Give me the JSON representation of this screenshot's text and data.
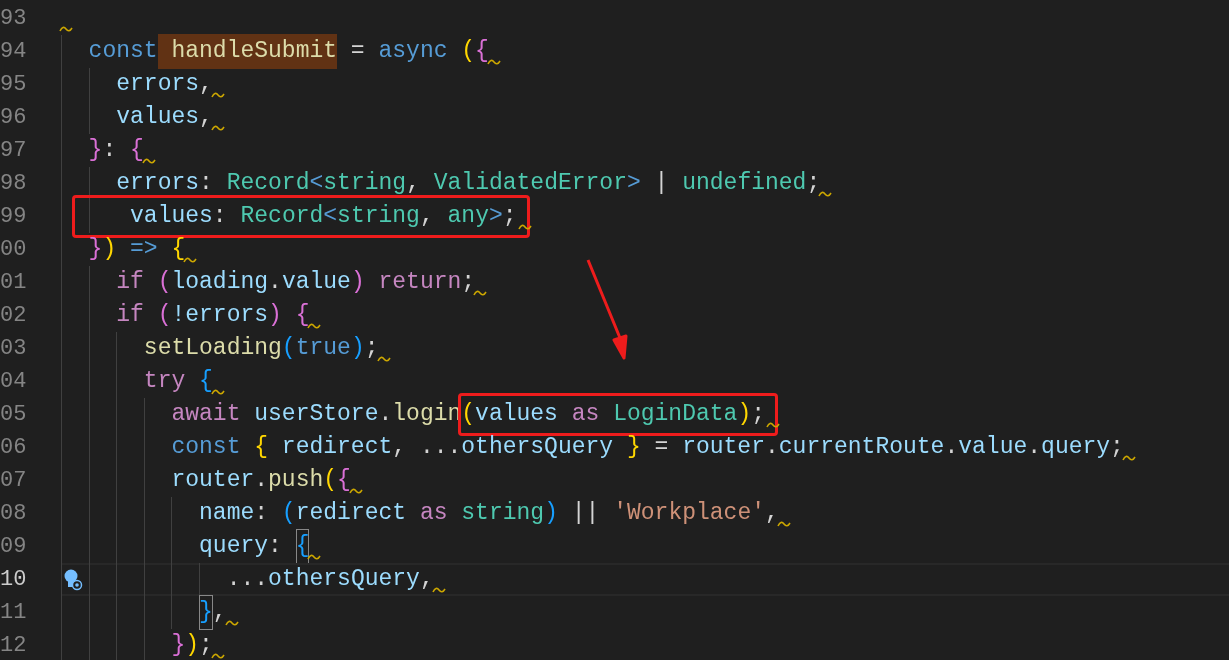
{
  "editor": {
    "lines": [
      {
        "number": "93",
        "current": false,
        "squiggle": true
      },
      {
        "number": "94",
        "current": false,
        "squiggle": true,
        "tokens": [
          {
            "text": "  const",
            "kind": "keyword"
          },
          {
            "text": " handleSubmit",
            "kind": "function",
            "highlighted": true
          },
          {
            "text": " = ",
            "kind": "punct"
          },
          {
            "text": "async",
            "kind": "keyword"
          },
          {
            "text": " (",
            "kind": "bracket1"
          },
          {
            "text": "{",
            "kind": "bracket2"
          }
        ]
      },
      {
        "number": "95",
        "current": false,
        "squiggle": true,
        "tokens": [
          {
            "text": "    errors",
            "kind": "variable"
          },
          {
            "text": ",",
            "kind": "punct"
          }
        ]
      },
      {
        "number": "96",
        "current": false,
        "squiggle": true,
        "tokens": [
          {
            "text": "    values",
            "kind": "variable"
          },
          {
            "text": ",",
            "kind": "punct"
          }
        ]
      },
      {
        "number": "97",
        "current": false,
        "squiggle": true,
        "tokens": [
          {
            "text": "  }",
            "kind": "bracket2"
          },
          {
            "text": ": ",
            "kind": "punct"
          },
          {
            "text": "{",
            "kind": "bracket2"
          }
        ]
      },
      {
        "number": "98",
        "current": false,
        "squiggle": true,
        "tokens": [
          {
            "text": "    errors",
            "kind": "variable"
          },
          {
            "text": ": ",
            "kind": "punct"
          },
          {
            "text": "Record",
            "kind": "type"
          },
          {
            "text": "<",
            "kind": "keyword"
          },
          {
            "text": "string",
            "kind": "type"
          },
          {
            "text": ", ",
            "kind": "punct"
          },
          {
            "text": "ValidatedError",
            "kind": "type"
          },
          {
            "text": ">",
            "kind": "keyword"
          },
          {
            "text": " | ",
            "kind": "punct"
          },
          {
            "text": "undefined",
            "kind": "type"
          },
          {
            "text": ";",
            "kind": "punct"
          }
        ]
      },
      {
        "number": "99",
        "current": false,
        "squiggle": true,
        "tokens": [
          {
            "kind": "annotation_box",
            "tokens": [
              {
                "text": "    values",
                "kind": "variable"
              },
              {
                "text": ": ",
                "kind": "punct"
              },
              {
                "text": "Record",
                "kind": "type"
              },
              {
                "text": "<",
                "kind": "keyword"
              },
              {
                "text": "string",
                "kind": "type"
              },
              {
                "text": ", ",
                "kind": "punct"
              },
              {
                "text": "any",
                "kind": "type"
              },
              {
                "text": ">",
                "kind": "keyword"
              },
              {
                "text": ";",
                "kind": "punct"
              }
            ]
          }
        ]
      },
      {
        "number": "00",
        "current": false,
        "squiggle": true,
        "tokens": [
          {
            "text": "  }",
            "kind": "bracket2"
          },
          {
            "text": ")",
            "kind": "bracket1"
          },
          {
            "text": " =>",
            "kind": "keyword"
          },
          {
            "text": " {",
            "kind": "bracket1"
          }
        ]
      },
      {
        "number": "01",
        "current": false,
        "squiggle": true,
        "tokens": [
          {
            "text": "    if",
            "kind": "control"
          },
          {
            "text": " (",
            "kind": "bracket2"
          },
          {
            "text": "loading",
            "kind": "variable"
          },
          {
            "text": ".",
            "kind": "punct"
          },
          {
            "text": "value",
            "kind": "variable"
          },
          {
            "text": ")",
            "kind": "bracket2"
          },
          {
            "text": " return",
            "kind": "control"
          },
          {
            "text": ";",
            "kind": "punct"
          }
        ]
      },
      {
        "number": "02",
        "current": false,
        "squiggle": true,
        "tokens": [
          {
            "text": "    if",
            "kind": "control"
          },
          {
            "text": " (",
            "kind": "bracket2"
          },
          {
            "text": "!errors",
            "kind": "variable"
          },
          {
            "text": ")",
            "kind": "bracket2"
          },
          {
            "text": " {",
            "kind": "bracket2"
          }
        ]
      },
      {
        "number": "03",
        "current": false,
        "squiggle": true,
        "tokens": [
          {
            "text": "      setLoading",
            "kind": "function"
          },
          {
            "text": "(",
            "kind": "bracket3"
          },
          {
            "text": "true",
            "kind": "keyword"
          },
          {
            "text": ")",
            "kind": "bracket3"
          },
          {
            "text": ";",
            "kind": "punct"
          }
        ]
      },
      {
        "number": "04",
        "current": false,
        "squiggle": true,
        "tokens": [
          {
            "text": "      try",
            "kind": "control"
          },
          {
            "text": " {",
            "kind": "bracket3"
          }
        ]
      },
      {
        "number": "05",
        "current": false,
        "squiggle": true,
        "tokens": [
          {
            "text": "        await",
            "kind": "control"
          },
          {
            "text": " userStore",
            "kind": "variable"
          },
          {
            "text": ".",
            "kind": "punct"
          },
          {
            "text": "login",
            "kind": "function"
          },
          {
            "kind": "annotation_box",
            "tokens": [
              {
                "text": "(",
                "kind": "bracket1"
              },
              {
                "text": "values",
                "kind": "variable"
              },
              {
                "text": " as",
                "kind": "control"
              },
              {
                "text": " LoginData",
                "kind": "type"
              },
              {
                "text": ")",
                "kind": "bracket1"
              },
              {
                "text": ";",
                "kind": "punct"
              }
            ]
          }
        ]
      },
      {
        "number": "06",
        "current": false,
        "squiggle": true,
        "tokens": [
          {
            "text": "        const",
            "kind": "keyword"
          },
          {
            "text": " {",
            "kind": "bracket1"
          },
          {
            "text": " redirect",
            "kind": "variable"
          },
          {
            "text": ", ...",
            "kind": "punct"
          },
          {
            "text": "othersQuery",
            "kind": "variable"
          },
          {
            "text": " }",
            "kind": "bracket1"
          },
          {
            "text": " = ",
            "kind": "punct"
          },
          {
            "text": "router",
            "kind": "variable"
          },
          {
            "text": ".",
            "kind": "punct"
          },
          {
            "text": "currentRoute",
            "kind": "variable"
          },
          {
            "text": ".",
            "kind": "punct"
          },
          {
            "text": "value",
            "kind": "variable"
          },
          {
            "text": ".",
            "kind": "punct"
          },
          {
            "text": "query",
            "kind": "variable"
          },
          {
            "text": ";",
            "kind": "punct"
          }
        ]
      },
      {
        "number": "07",
        "current": false,
        "squiggle": true,
        "tokens": [
          {
            "text": "        router",
            "kind": "variable"
          },
          {
            "text": ".",
            "kind": "punct"
          },
          {
            "text": "push",
            "kind": "function"
          },
          {
            "text": "(",
            "kind": "bracket1"
          },
          {
            "text": "{",
            "kind": "bracket2"
          }
        ]
      },
      {
        "number": "08",
        "current": false,
        "squiggle": true,
        "tokens": [
          {
            "text": "          name",
            "kind": "variable"
          },
          {
            "text": ": ",
            "kind": "punct"
          },
          {
            "text": "(",
            "kind": "bracket3"
          },
          {
            "text": "redirect",
            "kind": "variable"
          },
          {
            "text": " as",
            "kind": "control"
          },
          {
            "text": " string",
            "kind": "type"
          },
          {
            "text": ")",
            "kind": "bracket3"
          },
          {
            "text": " || ",
            "kind": "punct"
          },
          {
            "text": "'Workplace'",
            "kind": "string"
          },
          {
            "text": ",",
            "kind": "punct"
          }
        ]
      },
      {
        "number": "09",
        "current": false,
        "squiggle": true,
        "tokens": [
          {
            "text": "          query",
            "kind": "variable"
          },
          {
            "text": ": ",
            "kind": "punct"
          },
          {
            "text": "{",
            "kind": "bracket3",
            "matched": true
          }
        ]
      },
      {
        "number": "10",
        "current": true,
        "squiggle": true,
        "lightbulb": true,
        "tokens": [
          {
            "text": "            ...",
            "kind": "punct"
          },
          {
            "text": "othersQuery",
            "kind": "variable"
          },
          {
            "text": ",",
            "kind": "punct"
          }
        ]
      },
      {
        "number": "11",
        "current": false,
        "squiggle": true,
        "tokens": [
          {
            "text": "          }",
            "kind": "bracket3",
            "matched": true
          },
          {
            "text": ",",
            "kind": "punct"
          }
        ]
      },
      {
        "number": "12",
        "current": false,
        "squiggle": true,
        "tokens": [
          {
            "text": "        }",
            "kind": "bracket2"
          },
          {
            "text": ")",
            "kind": "bracket1"
          },
          {
            "text": ";",
            "kind": "punct"
          }
        ]
      }
    ]
  }
}
